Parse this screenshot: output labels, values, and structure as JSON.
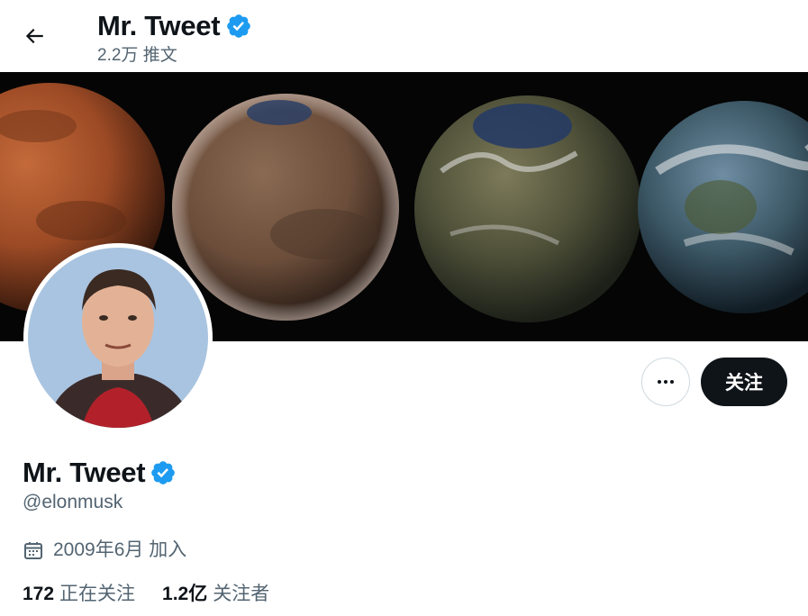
{
  "header": {
    "name": "Mr. Tweet",
    "tweet_count": "2.2万 推文"
  },
  "profile": {
    "name": "Mr. Tweet",
    "handle": "@elonmusk",
    "joined": "2009年6月 加入",
    "following_count": "172",
    "following_label": "正在关注",
    "followers_count": "1.2亿",
    "followers_label": "关注者"
  },
  "actions": {
    "follow_label": "关注"
  },
  "icons": {
    "back": "arrow-left-icon",
    "verified": "verified-badge-icon",
    "more": "more-dots-icon",
    "calendar": "calendar-icon"
  },
  "colors": {
    "verified_blue": "#1d9bf0",
    "follow_button": "#0f1419",
    "secondary_text": "#536471"
  }
}
